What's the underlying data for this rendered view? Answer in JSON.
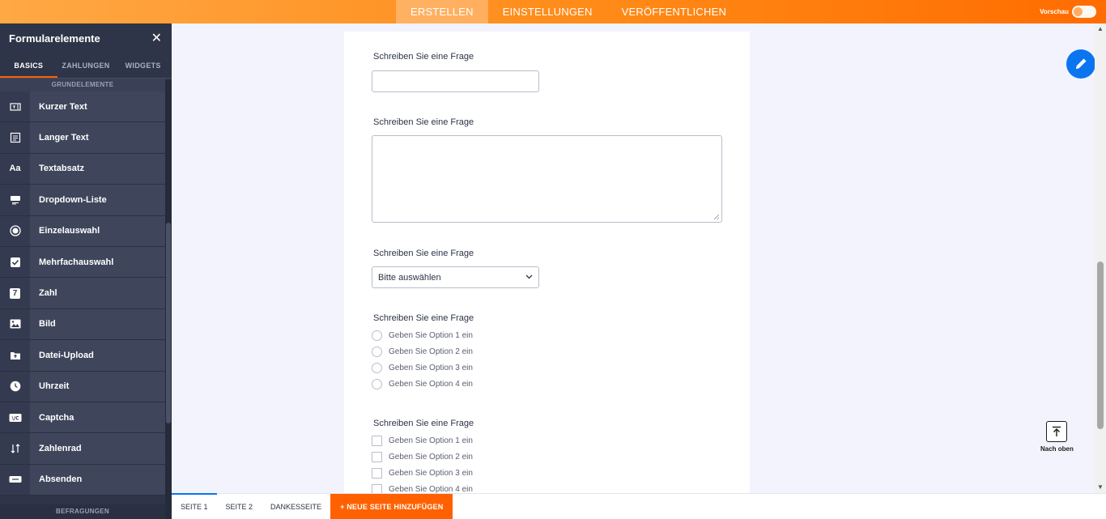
{
  "topbar": {
    "tabs": [
      {
        "label": "ERSTELLEN",
        "active": true
      },
      {
        "label": "EINSTELLUNGEN",
        "active": false
      },
      {
        "label": "VERÖFFENTLICHEN",
        "active": false
      }
    ],
    "preview_label": "Vorschau"
  },
  "sidebar": {
    "title": "Formularelemente",
    "tabs": [
      {
        "label": "BASICS",
        "active": true
      },
      {
        "label": "ZAHLUNGEN",
        "active": false
      },
      {
        "label": "WIDGETS",
        "active": false
      }
    ],
    "section_title": "GRUNDELEMENTE",
    "items": [
      {
        "label": "Kurzer Text",
        "icon": "short-text-icon"
      },
      {
        "label": "Langer Text",
        "icon": "long-text-icon"
      },
      {
        "label": "Textabsatz",
        "icon": "paragraph-icon",
        "glyph": "Aa"
      },
      {
        "label": "Dropdown-Liste",
        "icon": "dropdown-icon"
      },
      {
        "label": "Einzelauswahl",
        "icon": "radio-icon"
      },
      {
        "label": "Mehrfachauswahl",
        "icon": "checkbox-icon"
      },
      {
        "label": "Zahl",
        "icon": "number-icon",
        "glyph": "7"
      },
      {
        "label": "Bild",
        "icon": "image-icon"
      },
      {
        "label": "Datei-Upload",
        "icon": "file-upload-icon"
      },
      {
        "label": "Uhrzeit",
        "icon": "clock-icon"
      },
      {
        "label": "Captcha",
        "icon": "captcha-icon"
      },
      {
        "label": "Zahlenrad",
        "icon": "spinner-icon"
      },
      {
        "label": "Absenden",
        "icon": "submit-icon"
      }
    ],
    "footer_section": "BEFRAGUNGEN"
  },
  "form": {
    "short_text": {
      "question": "Schreiben Sie eine Frage"
    },
    "long_text": {
      "question": "Schreiben Sie eine Frage"
    },
    "dropdown": {
      "question": "Schreiben Sie eine Frage",
      "selected": "Bitte auswählen"
    },
    "single_choice": {
      "question": "Schreiben Sie eine Frage",
      "options": [
        "Geben Sie Option 1 ein",
        "Geben Sie Option 2 ein",
        "Geben Sie Option 3 ein",
        "Geben Sie Option 4 ein"
      ]
    },
    "multiple_choice": {
      "question": "Schreiben Sie eine Frage",
      "options": [
        "Geben Sie Option 1 ein",
        "Geben Sie Option 2 ein",
        "Geben Sie Option 3 ein",
        "Geben Sie Option 4 ein"
      ]
    }
  },
  "widgets": {
    "to_top_label": "Nach oben"
  },
  "pagebar": {
    "pages": [
      {
        "label": "SEITE 1",
        "active": true
      },
      {
        "label": "SEITE 2",
        "active": false
      },
      {
        "label": "DANKESSEITE",
        "active": false
      }
    ],
    "add_page_label": "+ NEUE SEITE HINZUFÜGEN"
  },
  "colors": {
    "accent": "#ff6100",
    "sidebar_bg": "#2f3548",
    "primary_blue": "#0b75f0"
  }
}
